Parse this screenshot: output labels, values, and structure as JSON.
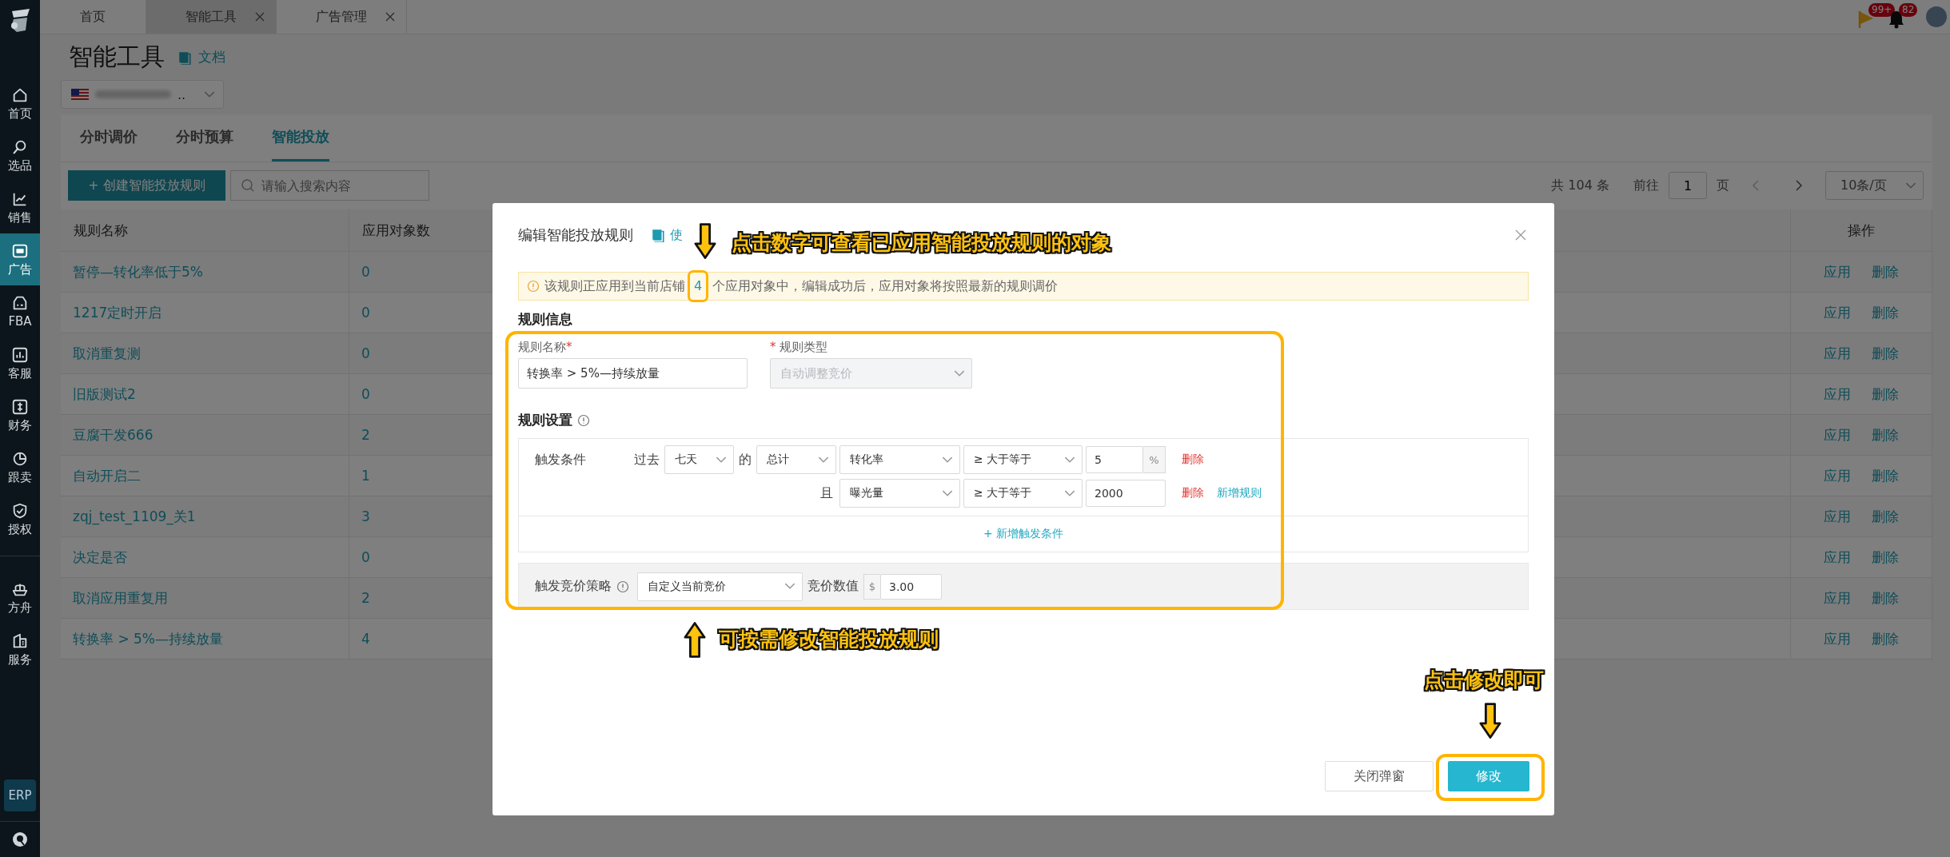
{
  "sidebar": {
    "groups": [
      [
        {
          "label": "首页",
          "selected": false
        },
        {
          "label": "选品",
          "selected": false
        },
        {
          "label": "销售",
          "selected": false
        },
        {
          "label": "广告",
          "selected": true
        },
        {
          "label": "FBA",
          "selected": false
        },
        {
          "label": "客服",
          "selected": false
        },
        {
          "label": "财务",
          "selected": false
        },
        {
          "label": "跟卖",
          "selected": false
        },
        {
          "label": "授权",
          "selected": false
        }
      ],
      [
        {
          "label": "方舟",
          "selected": false
        },
        {
          "label": "服务",
          "selected": false
        }
      ]
    ],
    "erp_button": "ERP"
  },
  "top_tabs": [
    {
      "label": "首页",
      "closable": false,
      "selected": false
    },
    {
      "label": "智能工具",
      "closable": true,
      "selected": true
    },
    {
      "label": "广告管理",
      "closable": true,
      "selected": false
    }
  ],
  "header_icons": [
    {
      "kind": "flag",
      "badge": "99+"
    },
    {
      "kind": "bell",
      "badge": "82"
    }
  ],
  "page": {
    "title": "智能工具",
    "doc_link": "文档",
    "store": {
      "name_end": ".."
    }
  },
  "tabs": [
    {
      "label": "分时调价",
      "selected": false
    },
    {
      "label": "分时预算",
      "selected": false
    },
    {
      "label": "智能投放",
      "selected": true
    }
  ],
  "create_button": "+ 创建智能投放规则",
  "search": {
    "placeholder": "请输入搜索内容"
  },
  "pagination": {
    "total": "共 104 条",
    "goto_label": "前往",
    "page": "1",
    "page_unit": "页",
    "page_size": "10条/页"
  },
  "table": {
    "columns": [
      "规则名称",
      "应用对象数",
      "操作"
    ],
    "rows": [
      {
        "name": "暂停—转化率低于5%",
        "count": "0",
        "actions": [
          "应用",
          "删除"
        ]
      },
      {
        "name": "1217定时开启",
        "count": "0",
        "actions": [
          "应用",
          "删除"
        ]
      },
      {
        "name": "取消重复测",
        "count": "0",
        "actions": [
          "应用",
          "删除"
        ]
      },
      {
        "name": "旧版测试2",
        "count": "0",
        "actions": [
          "应用",
          "删除"
        ]
      },
      {
        "name": "豆腐干发666",
        "count": "2",
        "actions": [
          "应用",
          "删除"
        ]
      },
      {
        "name": "自动开启二",
        "count": "1",
        "actions": [
          "应用",
          "删除"
        ]
      },
      {
        "name": "zqj_test_1109_关1",
        "count": "3",
        "actions": [
          "应用",
          "删除"
        ]
      },
      {
        "name": "决定是否",
        "count": "0",
        "actions": [
          "应用",
          "删除"
        ]
      },
      {
        "name": "取消应用重复用",
        "count": "2",
        "actions": [
          "应用",
          "删除"
        ]
      },
      {
        "name": "转换率 > 5%—持续放量",
        "count": "4",
        "actions": [
          "应用",
          "删除"
        ]
      }
    ]
  },
  "modal": {
    "title": "编辑智能投放规则",
    "help_link": "使",
    "notice": {
      "before": "该规则正应用到当前店铺",
      "count": "4",
      "after": "个应用对象中，编辑成功后，应用对象将按照最新的规则调价"
    },
    "section_info": "规则信息",
    "name_field": {
      "label": "规则名称",
      "mark_after": "*",
      "value": "转换率 > 5%—持续放量"
    },
    "type_field": {
      "mark_before": "*",
      "label": "规则类型",
      "value": "自动调整竞价",
      "disabled": true
    },
    "section_settings": "规则设置",
    "conditions": {
      "label": "触发条件",
      "period_prefix": "过去",
      "period": "七天",
      "period_suffix": "的",
      "aggregate": "总计",
      "rules": [
        {
          "metric": "转化率",
          "operator": "≥ 大于等于",
          "value": "5",
          "unit": "%",
          "delete": "删除"
        },
        {
          "joiner": "且",
          "metric": "曝光量",
          "operator": "≥ 大于等于",
          "value": "2000",
          "delete": "删除",
          "add": "新增规则"
        }
      ],
      "add_condition": "+ 新增触发条件"
    },
    "strategy": {
      "label": "触发竞价策略",
      "mode": "自定义当前竞价",
      "amount_label": "竞价数值",
      "currency": "$",
      "amount": "3.00"
    },
    "buttons": [
      {
        "label": "关闭弹窗",
        "kind": "secondary"
      },
      {
        "label": "修改",
        "kind": "primary"
      }
    ]
  },
  "annotations": [
    {
      "text": "点击数字可查看已应用智能投放规则的对象"
    },
    {
      "text": "可按需修改智能投放规则"
    },
    {
      "text": "点击修改即可"
    }
  ]
}
